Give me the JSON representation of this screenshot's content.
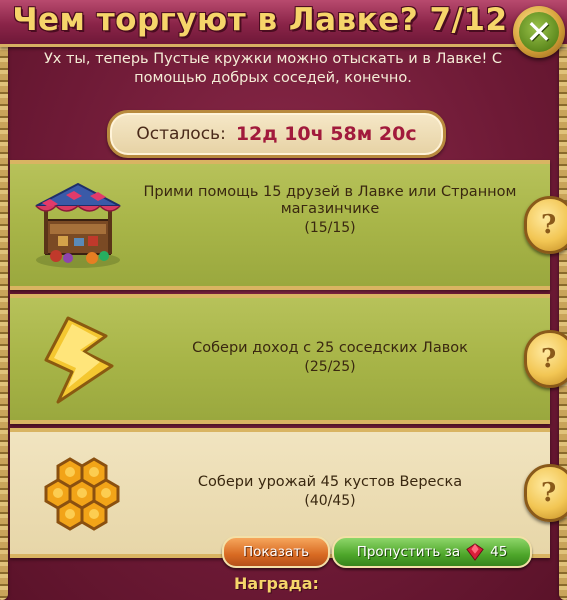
{
  "title": "Чем торгуют в Лавке? 7/12",
  "intro": "Ух ты, теперь Пустые кружки можно отыскать и в Лавке! С помощью добрых соседей, конечно.",
  "timer": {
    "label": "Осталось:",
    "value": "12д 10ч 58м 20с"
  },
  "tasks": [
    {
      "icon": "market-stall-icon",
      "text": "Прими помощь 15 друзей в Лавке или Странном магазинчике",
      "progress": "(15/15)",
      "status": "complete"
    },
    {
      "icon": "lightning-icon",
      "text": "Собери доход с 25 соседских Лавок",
      "progress": "(25/25)",
      "status": "complete"
    },
    {
      "icon": "honeycomb-icon",
      "text": "Собери урожай 45 кустов Вереска",
      "progress": "(40/45)",
      "status": "incomplete"
    }
  ],
  "help_symbol": "?",
  "buttons": {
    "show_label": "Показать",
    "skip_label": "Пропустить за",
    "skip_cost": "45",
    "currency_icon": "ruby-icon"
  },
  "reward_label": "Награда:",
  "colors": {
    "title": "#f6d56a",
    "complete_row": "#a8b548",
    "incomplete_row": "#e7d6a8",
    "timer_value": "#a11a3c"
  }
}
